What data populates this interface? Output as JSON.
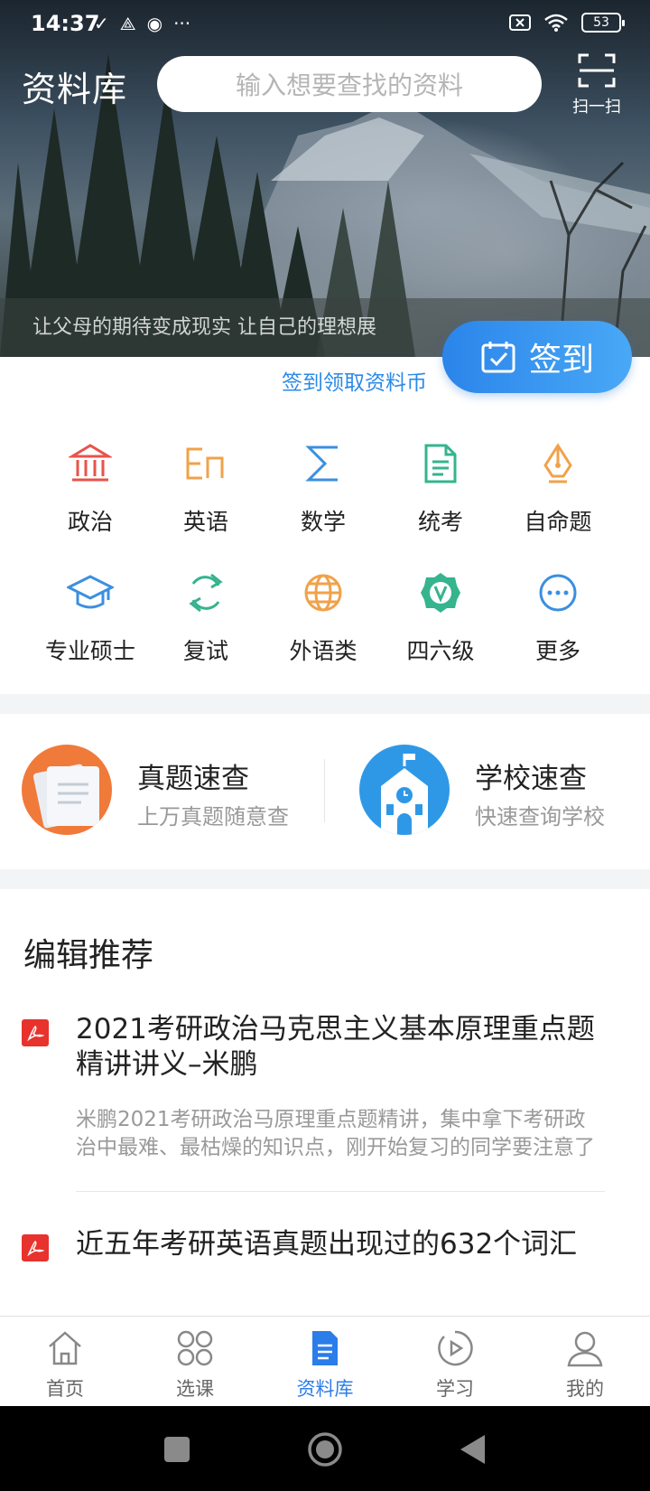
{
  "status_bar": {
    "time": "14:37",
    "battery": "53"
  },
  "header": {
    "title": "资料库",
    "search_placeholder": "输入想要查找的资料",
    "scan_label": "扫一扫",
    "slogan": "让父母的期待变成现实  让自己的理想展",
    "checkin_label": "签到",
    "checkin_hint": "签到领取资料币"
  },
  "categories": [
    {
      "label": "政治",
      "icon": "government-building-icon",
      "color": "#e8534a"
    },
    {
      "label": "英语",
      "icon": "english-en-icon",
      "color": "#f0a24a"
    },
    {
      "label": "数学",
      "icon": "sigma-icon",
      "color": "#3b8fe0"
    },
    {
      "label": "统考",
      "icon": "document-icon",
      "color": "#35b48e"
    },
    {
      "label": "自命题",
      "icon": "pen-nib-icon",
      "color": "#f0a24a"
    },
    {
      "label": "专业硕士",
      "icon": "graduation-cap-icon",
      "color": "#3b8fe0"
    },
    {
      "label": "复试",
      "icon": "refresh-cycle-icon",
      "color": "#35b48e"
    },
    {
      "label": "外语类",
      "icon": "globe-icon",
      "color": "#f0a24a"
    },
    {
      "label": "四六级",
      "icon": "v-badge-icon",
      "color": "#35b48e"
    },
    {
      "label": "更多",
      "icon": "more-dots-icon",
      "color": "#3b8fe0"
    }
  ],
  "quick_search": [
    {
      "title": "真题速查",
      "subtitle": "上万真题随意查",
      "icon": "papers-icon",
      "color": "#f07a3a"
    },
    {
      "title": "学校速查",
      "subtitle": "快速查询学校",
      "icon": "school-icon",
      "color": "#2f98e6"
    }
  ],
  "recommend": {
    "title": "编辑推荐",
    "items": [
      {
        "title": "2021考研政治马克思主义基本原理重点题精讲讲义–米鹏",
        "desc": "米鹏2021考研政治马原理重点题精讲，集中拿下考研政治中最难、最枯燥的知识点，刚开始复习的同学要注意了"
      },
      {
        "title": "近五年考研英语真题出现过的632个词汇",
        "desc": ""
      }
    ]
  },
  "tabs": [
    {
      "label": "首页",
      "icon": "home-icon"
    },
    {
      "label": "选课",
      "icon": "grid-apps-icon"
    },
    {
      "label": "资料库",
      "icon": "document-list-icon",
      "active": true
    },
    {
      "label": "学习",
      "icon": "play-circle-icon"
    },
    {
      "label": "我的",
      "icon": "user-icon"
    }
  ],
  "colors": {
    "accent": "#2b7de9",
    "checkin_start": "#2b85ea",
    "checkin_end": "#49a8f6"
  }
}
